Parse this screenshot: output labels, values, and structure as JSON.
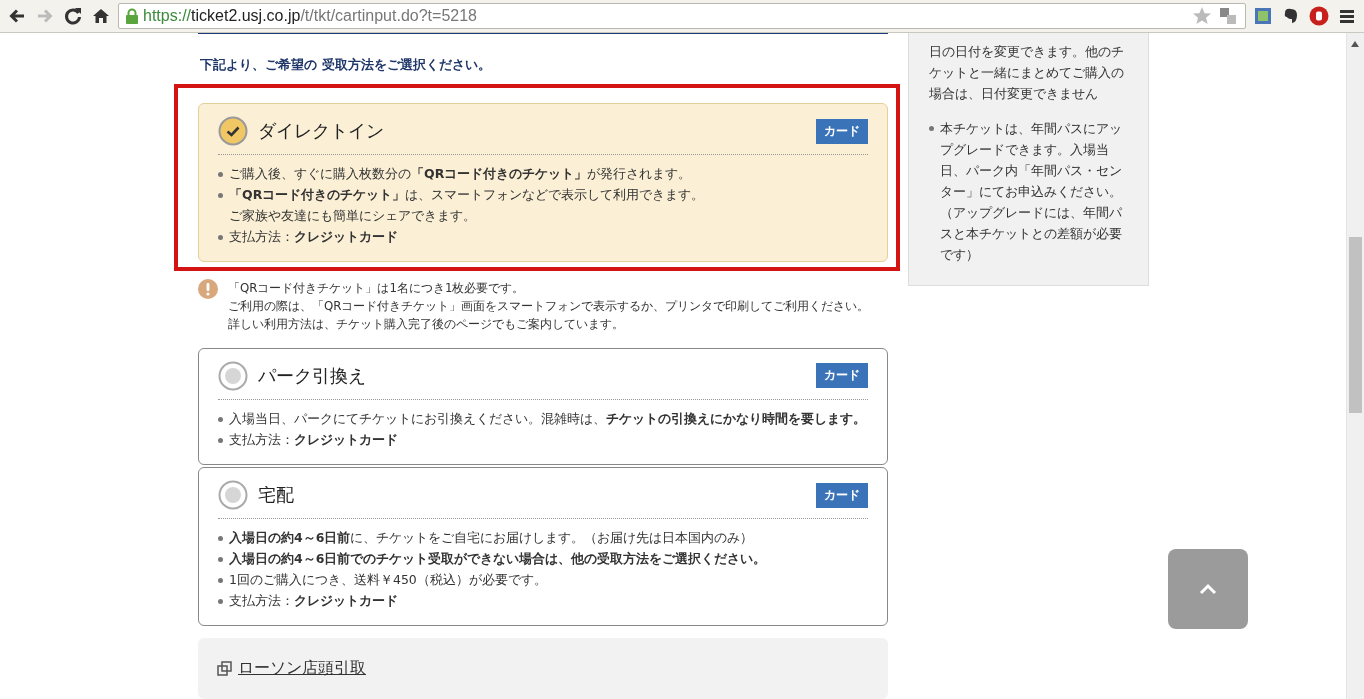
{
  "browser": {
    "url_scheme": "https://",
    "url_host": "ticket2.usj.co.jp",
    "url_path": "/t/tkt/cartinput.do?t=5218",
    "forward_disabled": true
  },
  "instruction": "下記より、ご希望の 受取方法をご選択ください。",
  "options": [
    {
      "title": "ダイレクトイン",
      "badge": "カード",
      "selected": true,
      "highlighted": true,
      "bullets": [
        "ご購入後、すぐに購入枚数分の**「QRコード付きのチケット」**が発行されます。",
        [
          "**「QRコード付きのチケット」**は、スマートフォンなどで表示して利用できます。",
          "ご家族や友達にも簡単にシェアできます。"
        ],
        "支払方法：**クレジットカード**"
      ]
    },
    {
      "title": "パーク引換え",
      "badge": "カード",
      "selected": false,
      "highlighted": false,
      "bullets": [
        "入場当日、パークにてチケットにお引換えください。混雑時は、**チケットの引換えにかなり時間を要します。**",
        "支払方法：**クレジットカード**"
      ]
    },
    {
      "title": "宅配",
      "badge": "カード",
      "selected": false,
      "highlighted": false,
      "bullets": [
        "**入場日の約4～6日前**に、チケットをご自宅にお届けします。（お届け先は日本国内のみ）",
        "**入場日の約4～6日前でのチケット受取ができない場合は、他の受取方法をご選択ください。**",
        "1回のご購入につき、送料￥450（税込）が必要です。",
        "支払方法：**クレジットカード**"
      ]
    }
  ],
  "notice": {
    "lines": [
      "「QRコード付きチケット」は1名につき1枚必要です。",
      "ご利用の際は、「QRコード付きチケット」画面をスマートフォンで表示するか、プリンタで印刷してご利用ください。",
      "詳しい利用方法は、チケット購入完了後のページでもご案内しています。"
    ]
  },
  "other_option": {
    "link": "ローソン店頭引取"
  },
  "sidebar": {
    "paragraphs": [
      {
        "text": "日の日付を変更できます。他のチケットと一緒にまとめてご購入の場合は、日付変更できません",
        "bullet": false
      },
      {
        "text": "本チケットは、年間パスにアップグレードできます。入場当日、パーク内「年間パス・センター」にてお申込みください。（アップグレードには、年間パスと本チケットとの差額が必要です）",
        "bullet": true
      }
    ]
  }
}
